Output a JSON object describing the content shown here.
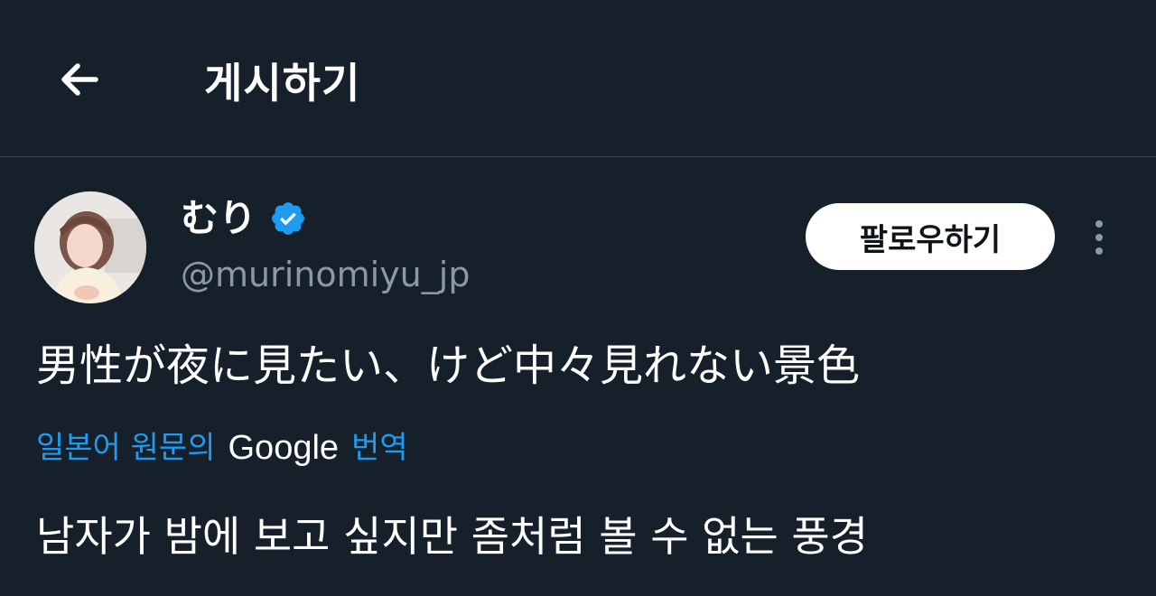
{
  "header": {
    "back_icon": "arrow-left-icon",
    "title": "게시하기"
  },
  "author": {
    "display_name": "むり",
    "verified_icon": "verified-badge-icon",
    "handle": "@murinomiyu_jp",
    "follow_label": "팔로우하기",
    "more_icon": "more-vertical-icon"
  },
  "post": {
    "text": "男性が夜に見たい、けど中々見れない景色",
    "translation_prefix": "일본어 원문의",
    "translation_provider": "Google",
    "translation_suffix": "번역",
    "translated_text": "남자가 밤에 보고 싶지만 좀처럼 볼 수 없는 풍경"
  },
  "colors": {
    "background": "#15202b",
    "link_blue": "#1d9bf0",
    "secondary_text": "#8b98a5",
    "verified_blue": "#1d9bf0"
  }
}
